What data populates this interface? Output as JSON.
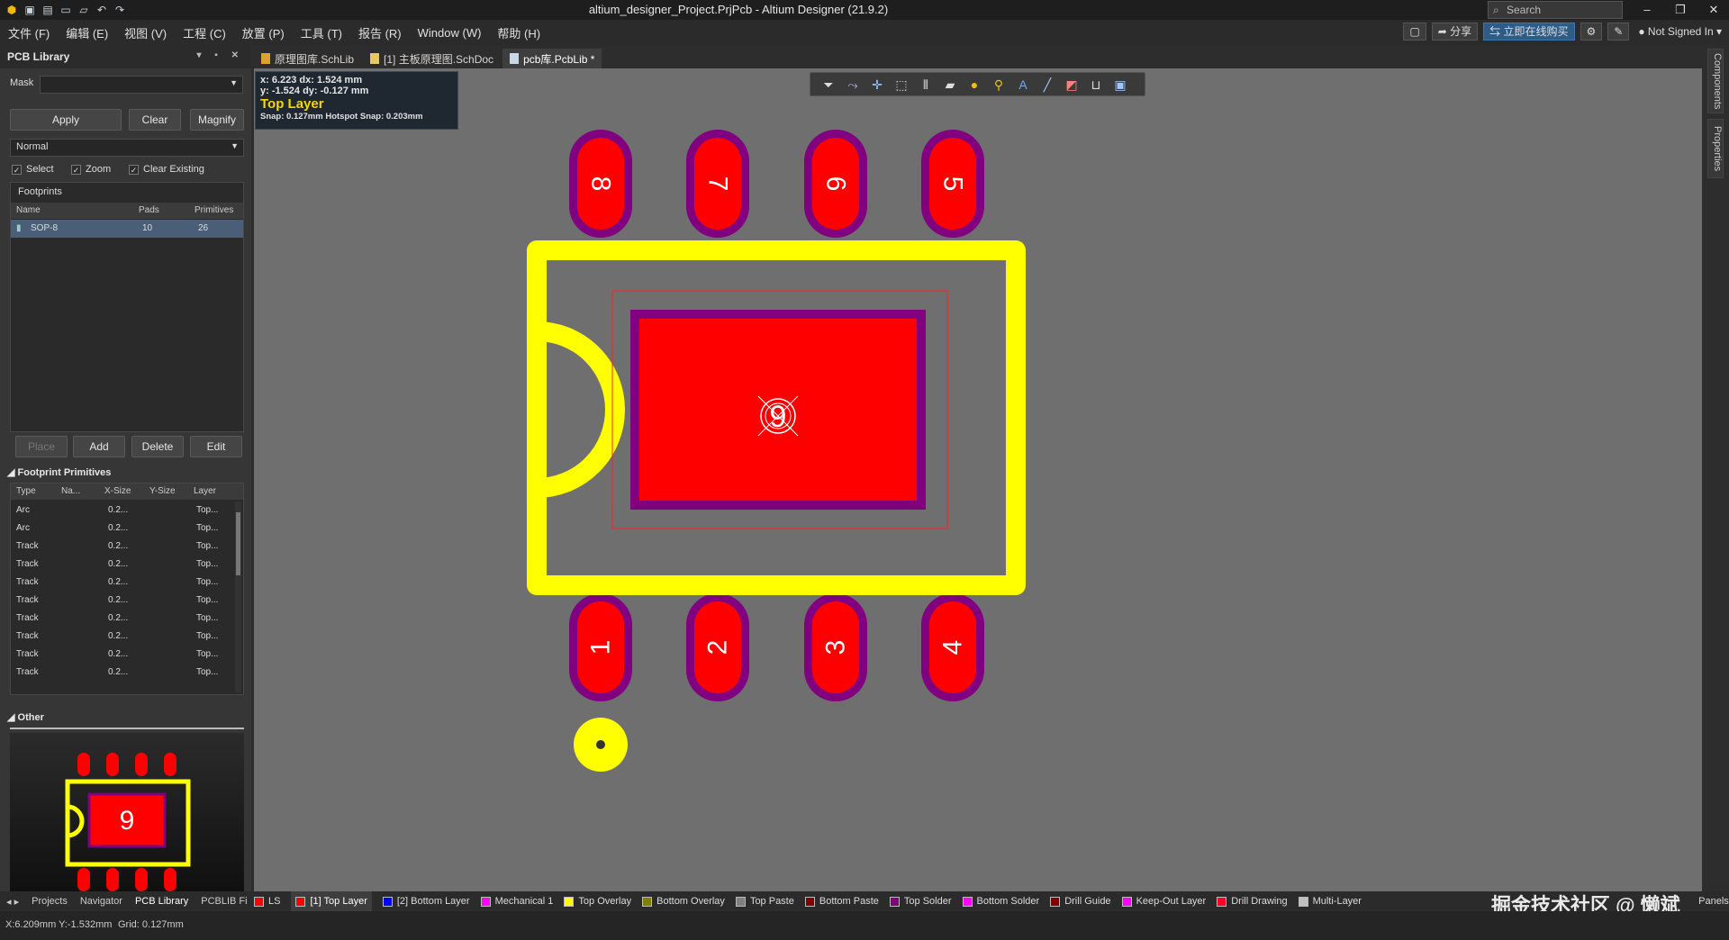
{
  "window": {
    "title": "altium_designer_Project.PrjPcb - Altium Designer (21.9.2)",
    "search_placeholder": "Search",
    "minimize": "–",
    "maximize": "❐",
    "close": "✕"
  },
  "menu": {
    "items": [
      "文件 (F)",
      "编辑 (E)",
      "视图 (V)",
      "工程 (C)",
      "放置 (P)",
      "工具 (T)",
      "报告 (R)",
      "Window (W)",
      "帮助 (H)"
    ],
    "share": "分享",
    "buy": "立即在线购买",
    "user": "Not Signed In"
  },
  "left_panel": {
    "title": "PCB Library",
    "mask_label": "Mask",
    "apply": "Apply",
    "clear": "Clear",
    "magnify": "Magnify",
    "mode": "Normal",
    "chk_select": "Select",
    "chk_zoom": "Zoom",
    "chk_clear_existing": "Clear Existing",
    "footprints_label": "Footprints",
    "fp_headers": [
      "Name",
      "Pads",
      "Primitives"
    ],
    "footprints": [
      {
        "name": "SOP-8",
        "pads": "10",
        "primitives": "26"
      }
    ],
    "place": "Place",
    "add": "Add",
    "delete": "Delete",
    "edit": "Edit",
    "primitives_section": "Footprint Primitives",
    "prim_headers": [
      "Type",
      "Na...",
      "X-Size",
      "Y-Size",
      "Layer"
    ],
    "primitives": [
      {
        "type": "Arc",
        "x": "0.2...",
        "layer": "Top..."
      },
      {
        "type": "Arc",
        "x": "0.2...",
        "layer": "Top..."
      },
      {
        "type": "Track",
        "x": "0.2...",
        "layer": "Top..."
      },
      {
        "type": "Track",
        "x": "0.2...",
        "layer": "Top..."
      },
      {
        "type": "Track",
        "x": "0.2...",
        "layer": "Top..."
      },
      {
        "type": "Track",
        "x": "0.2...",
        "layer": "Top..."
      },
      {
        "type": "Track",
        "x": "0.2...",
        "layer": "Top..."
      },
      {
        "type": "Track",
        "x": "0.2...",
        "layer": "Top..."
      },
      {
        "type": "Track",
        "x": "0.2...",
        "layer": "Top..."
      },
      {
        "type": "Track",
        "x": "0.2...",
        "layer": "Top..."
      }
    ],
    "other_section": "Other",
    "preview_pad": "9"
  },
  "bottom_tabs": [
    "Projects",
    "Navigator",
    "PCB Library",
    "PCBLIB Fi"
  ],
  "doc_tabs": [
    {
      "label": "原理图库.SchLib",
      "active": false
    },
    {
      "label": "[1] 主板原理图.SchDoc",
      "active": false
    },
    {
      "label": "pcb库.PcbLib *",
      "active": true
    }
  ],
  "hud": {
    "line1": "x: 6.223   dx: 1.524 mm",
    "line2": "y: -1.524   dy: -0.127 mm",
    "layer": "Top Layer",
    "snap": "Snap: 0.127mm Hotspot Snap: 0.203mm"
  },
  "pads": {
    "top": [
      "8",
      "7",
      "6",
      "5"
    ],
    "bottom": [
      "1",
      "2",
      "3",
      "4"
    ],
    "center": "9"
  },
  "right_tabs": [
    "Components",
    "Properties"
  ],
  "layers": [
    {
      "name": "LS",
      "color": "#ff0000",
      "active": false
    },
    {
      "name": "[1] Top Layer",
      "color": "#ff0000",
      "active": true
    },
    {
      "name": "[2] Bottom Layer",
      "color": "#0000ff",
      "active": false
    },
    {
      "name": "Mechanical 1",
      "color": "#ff00ff",
      "active": false
    },
    {
      "name": "Top Overlay",
      "color": "#ffff00",
      "active": false
    },
    {
      "name": "Bottom Overlay",
      "color": "#808000",
      "active": false
    },
    {
      "name": "Top Paste",
      "color": "#808080",
      "active": false
    },
    {
      "name": "Bottom Paste",
      "color": "#800000",
      "active": false
    },
    {
      "name": "Top Solder",
      "color": "#800080",
      "active": false
    },
    {
      "name": "Bottom Solder",
      "color": "#ff00ff",
      "active": false
    },
    {
      "name": "Drill Guide",
      "color": "#800000",
      "active": false
    },
    {
      "name": "Keep-Out Layer",
      "color": "#ff00ff",
      "active": false
    },
    {
      "name": "Drill Drawing",
      "color": "#ff002a",
      "active": false
    },
    {
      "name": "Multi-Layer",
      "color": "#c0c0c0",
      "active": false
    }
  ],
  "panels_button": "Panels",
  "status": {
    "coords": "X:6.209mm Y:-1.532mm",
    "grid": "Grid: 0.127mm"
  },
  "watermark": "掘金技术社区 @ 懒斌",
  "colors": {
    "pad": "#ff0000",
    "solder": "#800080",
    "overlay": "#ffff00",
    "canvas": "#6f6f6f"
  }
}
